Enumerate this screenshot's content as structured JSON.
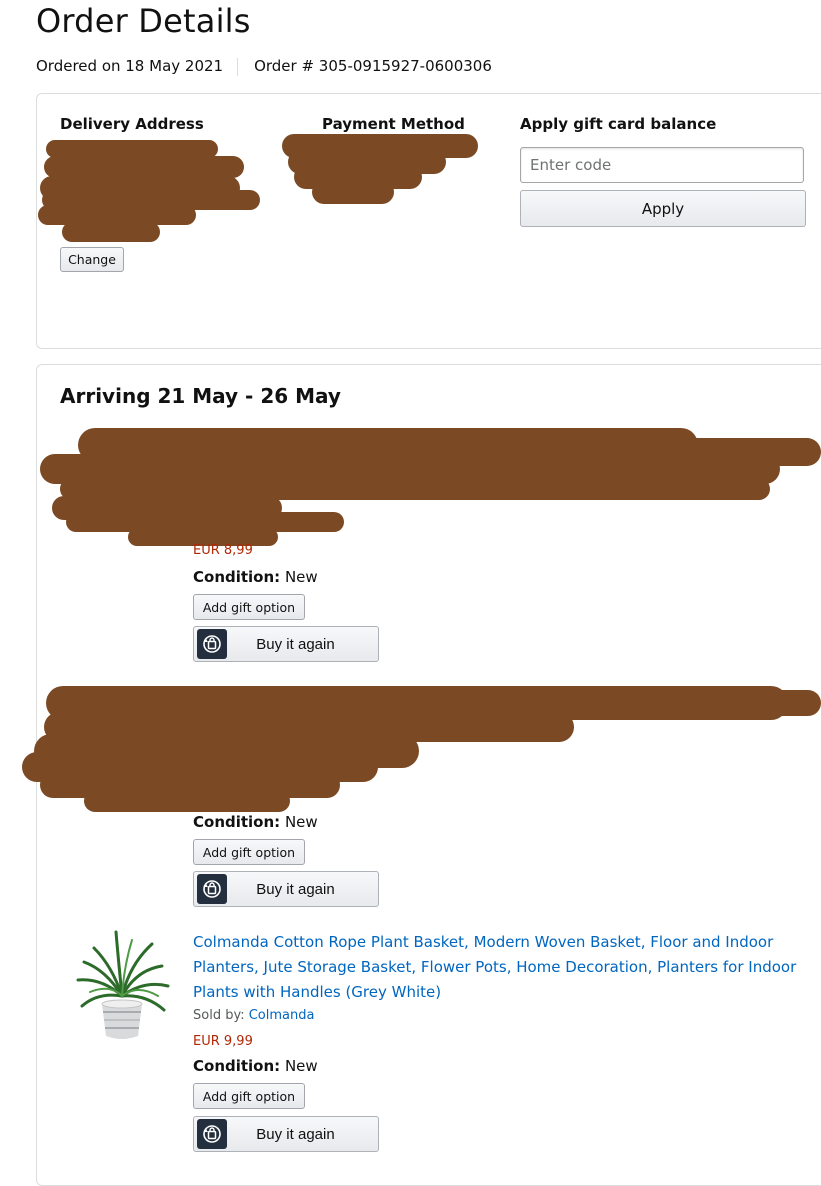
{
  "page": {
    "title": "Order Details",
    "ordered_on": "Ordered on 18 May 2021",
    "order_number": "Order # 305-0915927-0600306"
  },
  "summary": {
    "delivery_address_label": "Delivery Address",
    "change_label": "Change",
    "payment_method_label": "Payment Method",
    "gift_card_label": "Apply gift card balance",
    "code_placeholder": "Enter code",
    "apply_label": "Apply"
  },
  "shipment": {
    "arriving": "Arriving 21 May - 26 May",
    "items": [
      {
        "price": "EUR 8,99",
        "condition_label": "Condition:",
        "condition_value": "New",
        "gift_option_label": "Add gift option",
        "buy_again_label": "Buy it again"
      },
      {
        "condition_label": "Condition:",
        "condition_value": "New",
        "gift_option_label": "Add gift option",
        "buy_again_label": "Buy it again"
      },
      {
        "title": "Colmanda Cotton Rope Plant Basket, Modern Woven Basket, Floor and Indoor Planters, Jute Storage Basket, Flower Pots, Home Decoration, Planters for Indoor Plants with Handles (Grey White)",
        "sold_by_label": "Sold by:",
        "seller": "Colmanda",
        "price": "EUR 9,99",
        "condition_label": "Condition:",
        "condition_value": "New",
        "gift_option_label": "Add gift option",
        "buy_again_label": "Buy it again",
        "image_icon": "plant-pot-image"
      }
    ]
  },
  "colors": {
    "link": "#0066c0",
    "price": "#b12704",
    "redaction": "#7b4a24"
  }
}
